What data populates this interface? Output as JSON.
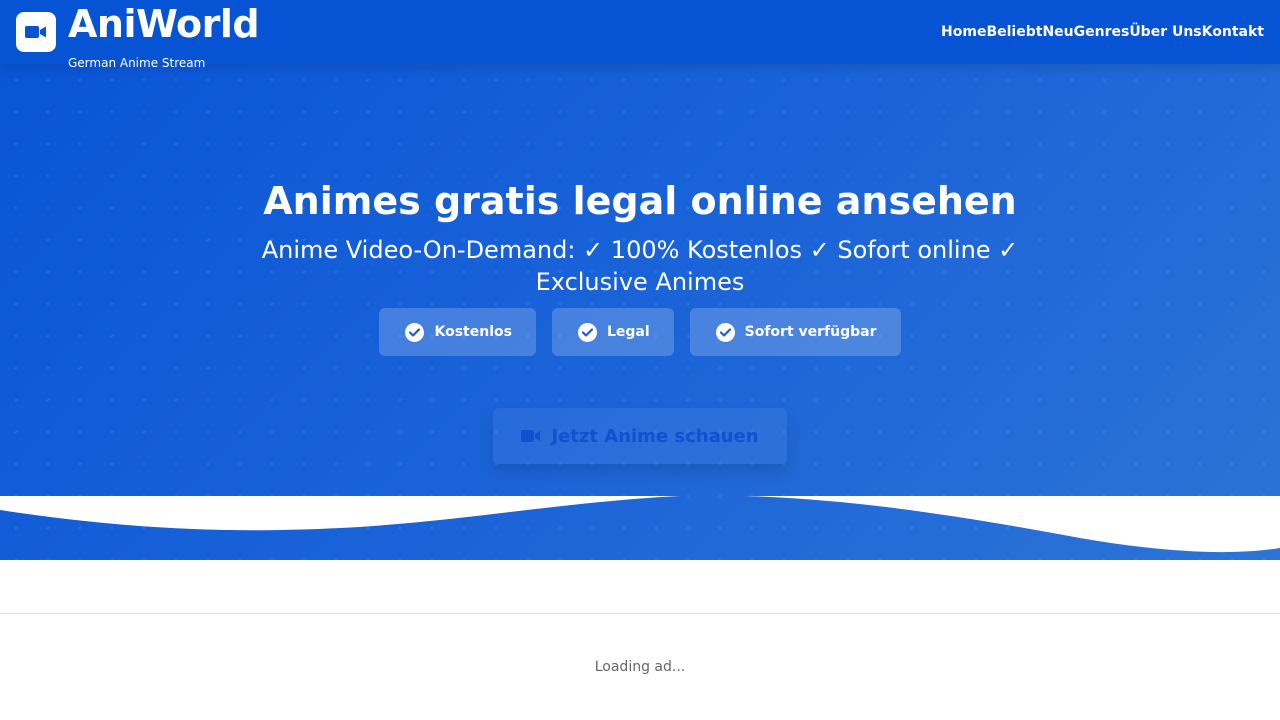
{
  "brand": {
    "name": "AniWorld",
    "tagline": "German Anime Stream",
    "logo_icon": "video-camera-icon",
    "color": "#0653d3"
  },
  "nav": {
    "items": [
      "Home",
      "Beliebt",
      "Neu",
      "Genres",
      "Über Uns",
      "Kontakt"
    ]
  },
  "hero": {
    "title": "Animes gratis legal online ansehen",
    "subtitle": "Anime Video-On-Demand: ✓ 100% Kostenlos ✓ Sofort online ✓ Exclusive Animes",
    "badges": [
      {
        "label": "Kostenlos",
        "icon": "check-circle-icon"
      },
      {
        "label": "Legal",
        "icon": "check-circle-icon"
      },
      {
        "label": "Sofort verfügbar",
        "icon": "check-circle-icon"
      }
    ],
    "cta": {
      "label": "Jetzt Anime schauen",
      "icon": "video-camera-icon"
    }
  },
  "ad": {
    "status": "Loading ad..."
  }
}
